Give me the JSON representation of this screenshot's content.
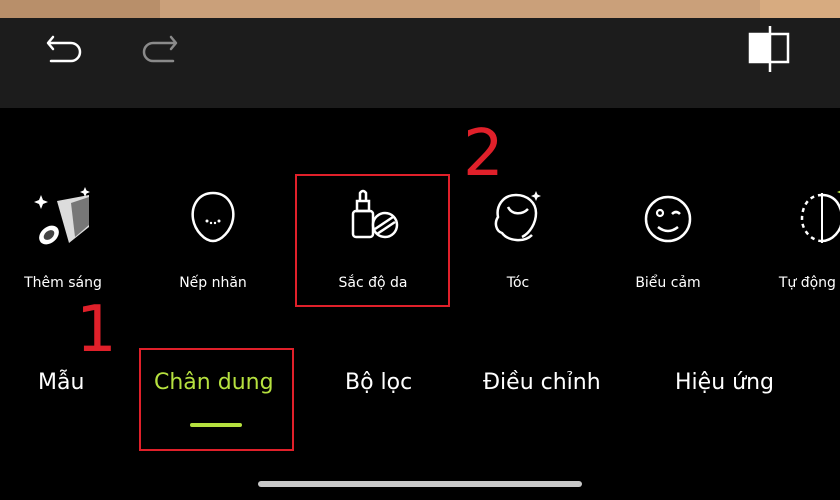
{
  "colors": {
    "accent": "#b6e13f",
    "annotation_red": "#e0202a",
    "topbar": "#1c1c1c",
    "background": "#000000"
  },
  "topbar": {
    "undo_icon": "undo-icon",
    "redo_icon": "redo-icon",
    "compare_icon": "compare-icon"
  },
  "tools": [
    {
      "label": "Thêm sáng",
      "icon": "spotlight-icon"
    },
    {
      "label": "Nếp nhăn",
      "icon": "face-wrinkle-icon"
    },
    {
      "label": "Sắc độ da",
      "icon": "skin-tone-bottle-icon"
    },
    {
      "label": "Tóc",
      "icon": "hair-icon"
    },
    {
      "label": "Biểu cảm",
      "icon": "wink-face-icon"
    },
    {
      "label": "Tự động sửa",
      "icon": "auto-fix-face-icon"
    }
  ],
  "tabs": [
    {
      "label": "Mẫu",
      "active": false
    },
    {
      "label": "Chân dung",
      "active": true
    },
    {
      "label": "Bộ lọc",
      "active": false
    },
    {
      "label": "Điều chỉnh",
      "active": false
    },
    {
      "label": "Hiệu ứng",
      "active": false
    }
  ],
  "annotations": {
    "step1": "1",
    "step2": "2"
  }
}
